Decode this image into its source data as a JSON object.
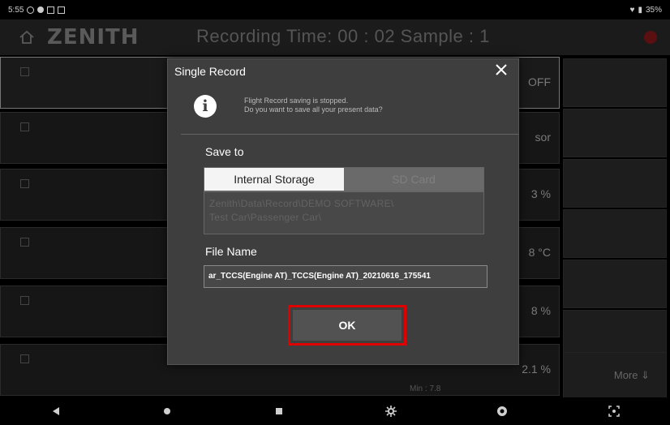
{
  "status_bar": {
    "time": "5:55",
    "battery": "35%"
  },
  "header": {
    "logo": "ZENITH",
    "recording_title": "Recording Time: 00 : 02 Sample : 1"
  },
  "background": {
    "row_values": [
      "OFF",
      "sor",
      "3 %",
      "8 °C",
      "8 %",
      "2.1 %"
    ],
    "min_label": "Min : 7.8",
    "side_more": "More ⇓"
  },
  "dialog": {
    "title": "Single Record",
    "message_line1": "Flight Record saving is stopped.",
    "message_line2": "Do you want to save all your present data?",
    "save_to_label": "Save to",
    "tabs": [
      {
        "label": "Internal Storage",
        "active": true
      },
      {
        "label": "SD Card",
        "active": false
      }
    ],
    "path_line1": "Zenith\\Data\\Record\\DEMO SOFTWARE\\",
    "path_line2": "Test Car\\Passenger Car\\",
    "file_name_label": "File Name",
    "file_name_value": "ar_TCCS(Engine AT)_TCCS(Engine AT)_20210616_175541",
    "ok_label": "OK"
  },
  "colors": {
    "highlight": "#e00000",
    "dialog_bg": "#3e3e3e",
    "recording_dot": "#5a1010"
  },
  "icons": [
    "home-icon",
    "info-icon",
    "close-icon",
    "back-icon",
    "home-nav-icon",
    "recents-icon",
    "settings-icon",
    "app-icon",
    "screenshot-icon"
  ]
}
